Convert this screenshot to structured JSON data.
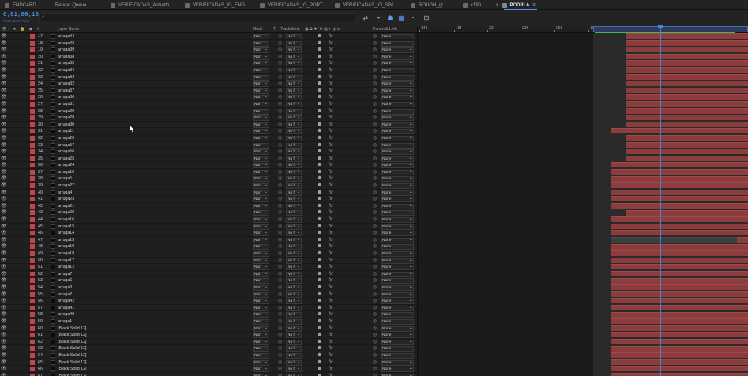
{
  "tabs": [
    {
      "label": "ENDCARD",
      "active": false
    },
    {
      "label": "Render Queue",
      "active": false
    },
    {
      "label": "VERIFICADAS_Armado",
      "active": false
    },
    {
      "label": "VERIFICADAS_IG_ENG",
      "active": false
    },
    {
      "label": "VERIFICADAS_IG_PORT",
      "active": false
    },
    {
      "label": "VERIFICADAS_IG_SPA",
      "active": false
    },
    {
      "label": "ROUGH_gr",
      "active": false
    },
    {
      "label": "c190",
      "active": false
    },
    {
      "label": "PODRI A",
      "active": true
    }
  ],
  "tab_close": "×",
  "tab_menu": "≡",
  "timecode": "0;01;06;18",
  "fps": "0033 (29.97 fps)",
  "search_icon": "search-icon",
  "headers": {
    "layer_name": "Layer Name",
    "mode": "Mode",
    "t": "T",
    "track_matte": "TrackMatte",
    "parent": "Parent & Link"
  },
  "ruler_ticks": [
    "14f",
    "18f",
    "22f",
    "02f",
    "06f",
    "10f",
    "14f",
    "18f",
    "22f",
    "26f"
  ],
  "row_values": {
    "mode": "Norr",
    "track_matte": "No h",
    "parent": "None",
    "fx": "fx",
    "shy": "☗",
    "eye": "👁",
    "matte_icon": "◎",
    "pickwhip": "◎",
    "chevron": "⌄"
  },
  "layers": [
    {
      "num": "17",
      "name": "arruga44"
    },
    {
      "num": "18",
      "name": "arruga43"
    },
    {
      "num": "19",
      "name": "arruga39"
    },
    {
      "num": "20",
      "name": "arruga38"
    },
    {
      "num": "21",
      "name": "arruga35"
    },
    {
      "num": "22",
      "name": "arruga34"
    },
    {
      "num": "23",
      "name": "arruga33"
    },
    {
      "num": "24",
      "name": "arruga32"
    },
    {
      "num": "25",
      "name": "arruga37"
    },
    {
      "num": "26",
      "name": "arruga36"
    },
    {
      "num": "27",
      "name": "arruga31"
    },
    {
      "num": "28",
      "name": "arruga29"
    },
    {
      "num": "29",
      "name": "arruga28"
    },
    {
      "num": "30",
      "name": "arruga30"
    },
    {
      "num": "31",
      "name": "arruga11"
    },
    {
      "num": "32",
      "name": "arruga26"
    },
    {
      "num": "33",
      "name": "arruga57"
    },
    {
      "num": "34",
      "name": "arruga56"
    },
    {
      "num": "35",
      "name": "arruga25"
    },
    {
      "num": "36",
      "name": "arruga24"
    },
    {
      "num": "37",
      "name": "arruga10"
    },
    {
      "num": "38",
      "name": "arruga5"
    },
    {
      "num": "39",
      "name": "arruga27"
    },
    {
      "num": "40",
      "name": "arruga4"
    },
    {
      "num": "41",
      "name": "arruga23"
    },
    {
      "num": "42",
      "name": "arruga21"
    },
    {
      "num": "43",
      "name": "arruga20"
    },
    {
      "num": "44",
      "name": "arruga16"
    },
    {
      "num": "45",
      "name": "arruga15"
    },
    {
      "num": "46",
      "name": "arruga14"
    },
    {
      "num": "47",
      "name": "arruga13"
    },
    {
      "num": "48",
      "name": "arruga19"
    },
    {
      "num": "49",
      "name": "arruga18"
    },
    {
      "num": "50",
      "name": "arruga17"
    },
    {
      "num": "51",
      "name": "arruga12"
    },
    {
      "num": "52",
      "name": "arruga7"
    },
    {
      "num": "53",
      "name": "arruga6"
    },
    {
      "num": "54",
      "name": "arruga3"
    },
    {
      "num": "55",
      "name": "arruga2"
    },
    {
      "num": "56",
      "name": "arruga42"
    },
    {
      "num": "57",
      "name": "arruga41"
    },
    {
      "num": "58",
      "name": "arruga40"
    },
    {
      "num": "59",
      "name": "arruga1"
    },
    {
      "num": "60",
      "name": "[Black Solid 12]"
    },
    {
      "num": "61",
      "name": "[Black Solid 12]"
    },
    {
      "num": "62",
      "name": "[Black Solid 12]"
    },
    {
      "num": "63",
      "name": "[Black Solid 12]"
    },
    {
      "num": "64",
      "name": "[Black Solid 12]"
    },
    {
      "num": "65",
      "name": "[Black Solid 12]"
    },
    {
      "num": "66",
      "name": "[Black Solid 12]"
    },
    {
      "num": "67",
      "name": "[Black Solid 12]"
    }
  ],
  "colors": {
    "label_red": "#c0464b",
    "bar_red": "#8c3c3c",
    "accent_blue": "#4a90e2",
    "work_green": "#3fb84f"
  }
}
